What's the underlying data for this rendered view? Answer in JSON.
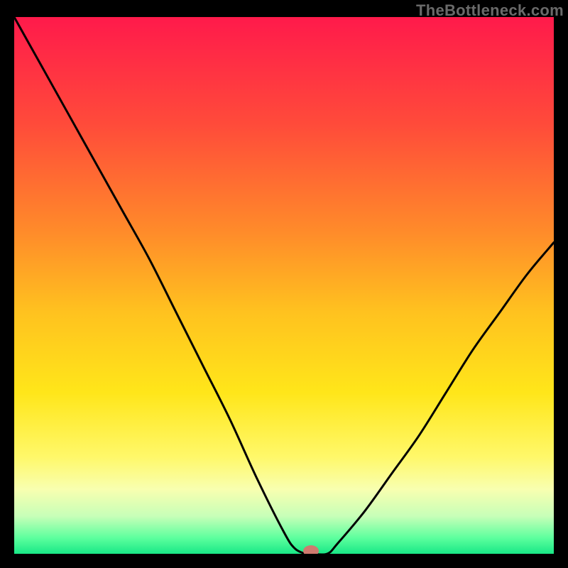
{
  "attribution": "TheBottleneck.com",
  "chart_data": {
    "type": "line",
    "title": "",
    "xlabel": "",
    "ylabel": "",
    "xlim": [
      0,
      100
    ],
    "ylim": [
      0,
      100
    ],
    "series": [
      {
        "name": "bottleneck-curve",
        "x": [
          0,
          5,
          10,
          15,
          20,
          25,
          30,
          35,
          40,
          45,
          50,
          52,
          54,
          55,
          58,
          60,
          65,
          70,
          75,
          80,
          85,
          90,
          95,
          100
        ],
        "values": [
          100,
          91,
          82,
          73,
          64,
          55,
          45,
          35,
          25,
          14,
          4,
          1,
          0,
          0,
          0,
          2,
          8,
          15,
          22,
          30,
          38,
          45,
          52,
          58
        ]
      }
    ],
    "marker": {
      "x": 55,
      "y": 0,
      "color": "#cf7a6f"
    },
    "background_gradient": {
      "stops": [
        {
          "offset": 0.0,
          "color": "#ff1a4b"
        },
        {
          "offset": 0.2,
          "color": "#ff4b3a"
        },
        {
          "offset": 0.4,
          "color": "#ff8b2a"
        },
        {
          "offset": 0.55,
          "color": "#ffc21f"
        },
        {
          "offset": 0.7,
          "color": "#ffe61a"
        },
        {
          "offset": 0.82,
          "color": "#fff86a"
        },
        {
          "offset": 0.88,
          "color": "#f8ffb0"
        },
        {
          "offset": 0.93,
          "color": "#c7ffb8"
        },
        {
          "offset": 0.97,
          "color": "#5eff9e"
        },
        {
          "offset": 1.0,
          "color": "#18e886"
        }
      ]
    },
    "curve_color": "#000000",
    "curve_width": 3
  }
}
